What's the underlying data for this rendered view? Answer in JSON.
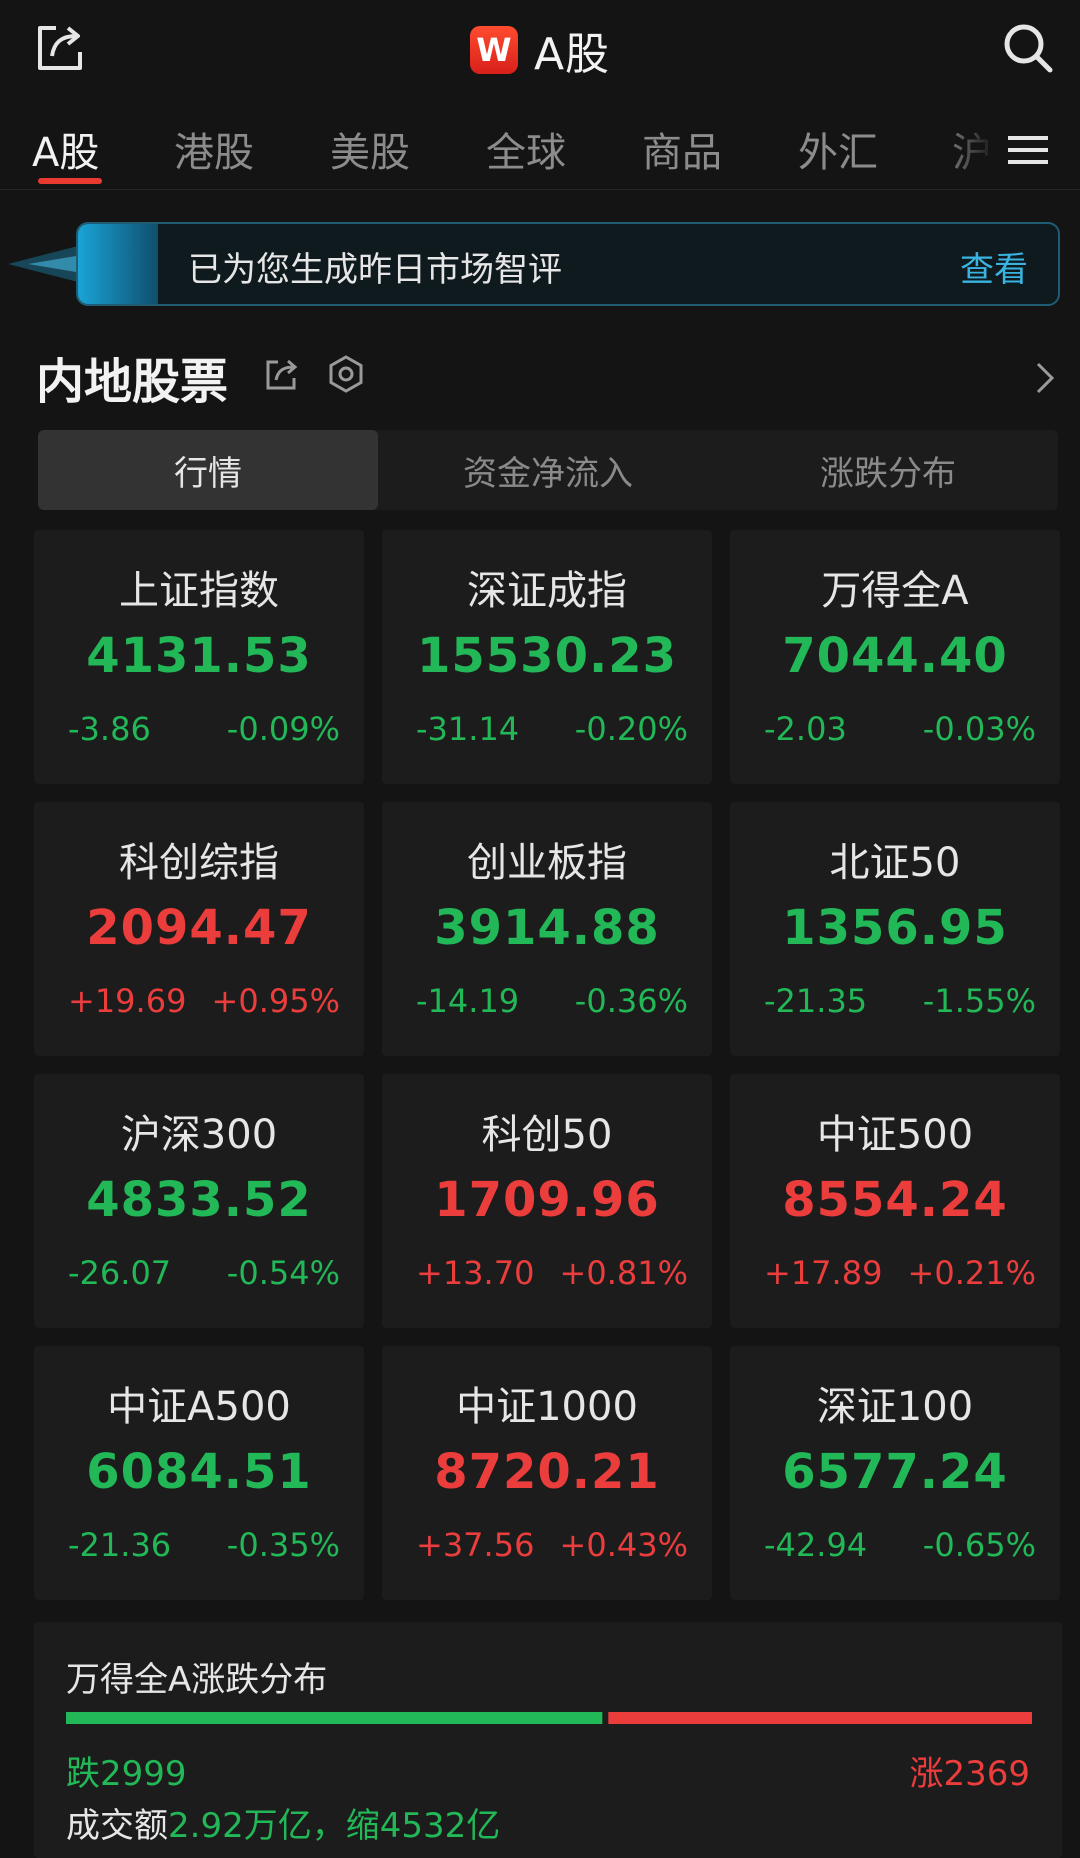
{
  "header": {
    "logo_letter": "W",
    "title": "A股"
  },
  "tabs": [
    {
      "label": "A股"
    },
    {
      "label": "港股"
    },
    {
      "label": "美股"
    },
    {
      "label": "全球"
    },
    {
      "label": "商品"
    },
    {
      "label": "外汇"
    },
    {
      "label": "沪"
    }
  ],
  "banner": {
    "text": "已为您生成昨日市场智评",
    "action": "查看"
  },
  "section": {
    "title": "内地股票"
  },
  "segments": [
    {
      "label": "行情"
    },
    {
      "label": "资金净流入"
    },
    {
      "label": "涨跌分布"
    }
  ],
  "indices": [
    {
      "name": "上证指数",
      "value": "4131.53",
      "change": "-3.86",
      "pct": "-0.09%",
      "dir": "down"
    },
    {
      "name": "深证成指",
      "value": "15530.23",
      "change": "-31.14",
      "pct": "-0.20%",
      "dir": "down"
    },
    {
      "name": "万得全A",
      "value": "7044.40",
      "change": "-2.03",
      "pct": "-0.03%",
      "dir": "down"
    },
    {
      "name": "科创综指",
      "value": "2094.47",
      "change": "+19.69",
      "pct": "+0.95%",
      "dir": "up"
    },
    {
      "name": "创业板指",
      "value": "3914.88",
      "change": "-14.19",
      "pct": "-0.36%",
      "dir": "down"
    },
    {
      "name": "北证50",
      "value": "1356.95",
      "change": "-21.35",
      "pct": "-1.55%",
      "dir": "down"
    },
    {
      "name": "沪深300",
      "value": "4833.52",
      "change": "-26.07",
      "pct": "-0.54%",
      "dir": "down"
    },
    {
      "name": "科创50",
      "value": "1709.96",
      "change": "+13.70",
      "pct": "+0.81%",
      "dir": "up"
    },
    {
      "name": "中证500",
      "value": "8554.24",
      "change": "+17.89",
      "pct": "+0.21%",
      "dir": "up"
    },
    {
      "name": "中证A500",
      "value": "6084.51",
      "change": "-21.36",
      "pct": "-0.35%",
      "dir": "down"
    },
    {
      "name": "中证1000",
      "value": "8720.21",
      "change": "+37.56",
      "pct": "+0.43%",
      "dir": "up"
    },
    {
      "name": "深证100",
      "value": "6577.24",
      "change": "-42.94",
      "pct": "-0.65%",
      "dir": "down"
    }
  ],
  "distribution": {
    "title": "万得全A涨跌分布",
    "fall_label": "跌2999",
    "rise_label": "涨2369",
    "fall_count": 2999,
    "rise_count": 2369,
    "volume_label": "成交额",
    "volume_value": "2.92万亿，缩4532亿"
  },
  "colors": {
    "up": "#ec3d3d",
    "down": "#22b757",
    "accent": "#e83a30",
    "link": "#39b4e0"
  }
}
